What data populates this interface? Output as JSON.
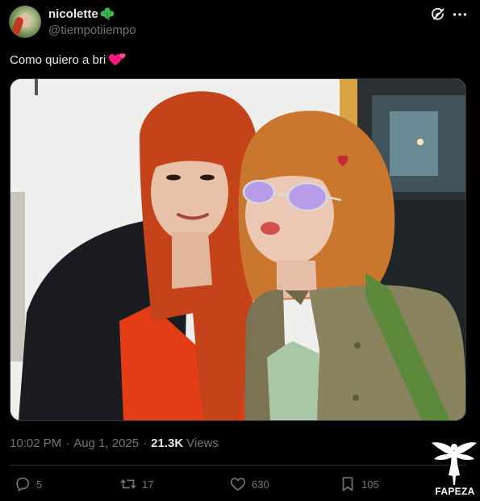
{
  "post": {
    "author": {
      "display_name": "nicolette",
      "name_emoji": "clover-emoji",
      "handle": "@tiempotiiempo"
    },
    "text": "Como quiero a bri",
    "text_emoji": "two-hearts-emoji",
    "media": {
      "type": "photo",
      "subject": "two people posing together"
    },
    "timestamp": {
      "time": "10:02 PM",
      "separator": "·",
      "date": "Aug 1, 2025",
      "views_count": "21.3K",
      "views_label": "Views"
    },
    "actions": {
      "replies": "5",
      "reposts": "17",
      "likes": "630",
      "bookmarks": "105"
    },
    "header_icons": [
      "grok-icon",
      "more-icon"
    ]
  },
  "watermark": {
    "text": "FAPEZA",
    "logo": "winged-figure-logo"
  },
  "colors": {
    "background": "#000000",
    "primary_text": "#e7e9ea",
    "secondary_text": "#71767b",
    "divider": "#2f3336",
    "hearts": "#f91880",
    "clover": "#3fb34f"
  }
}
